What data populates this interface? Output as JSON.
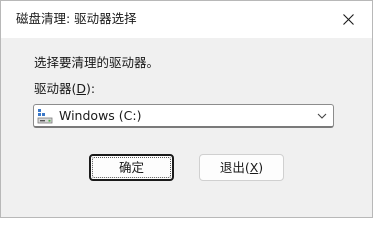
{
  "window": {
    "title": "磁盘清理: 驱动器选择"
  },
  "dialog": {
    "prompt": "选择要清理的驱动器。",
    "drive_label_prefix": "驱动器(",
    "drive_label_accel": "D",
    "drive_label_suffix": "):",
    "drive_selected": "Windows (C:)",
    "drive_icon": "drive-icon"
  },
  "buttons": {
    "ok_label": "确定",
    "exit_prefix": "退出(",
    "exit_accel": "X",
    "exit_suffix": ")"
  },
  "colors": {
    "focus_border": "#1a1a1a",
    "drive_icon_blue": "#3a78c8",
    "drive_icon_green": "#4caa46"
  }
}
